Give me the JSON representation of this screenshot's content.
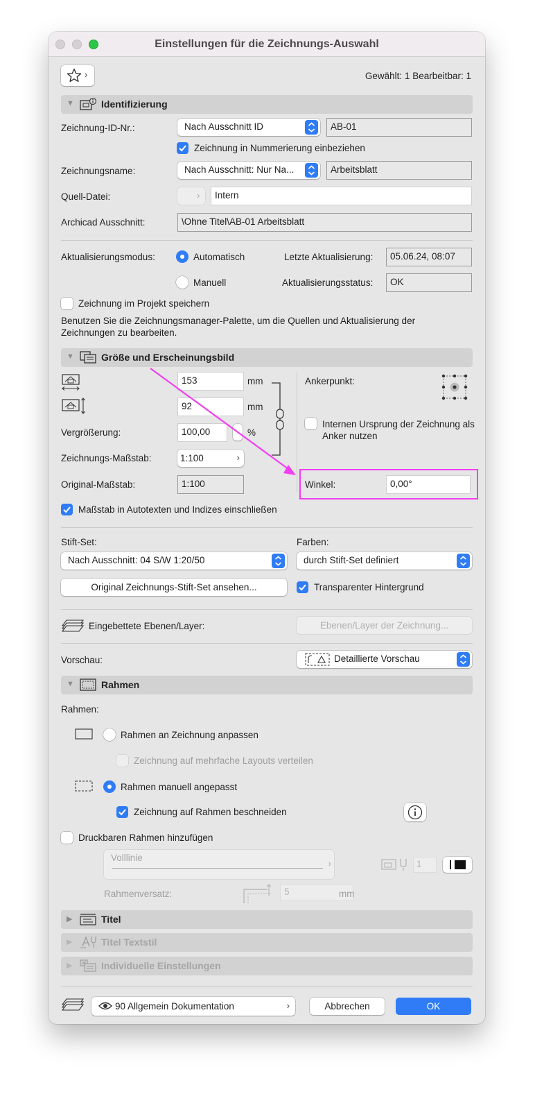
{
  "window": {
    "title": "Einstellungen für die Zeichnungs-Auswahl"
  },
  "header": {
    "selection_status": "Gewählt: 1 Bearbeitbar: 1"
  },
  "sections": {
    "identifizierung": "Identifizierung",
    "groesse": "Größe und Erscheinungsbild",
    "rahmen": "Rahmen",
    "titel": "Titel",
    "titel_textstil": "Titel Textstil",
    "individuelle": "Individuelle Einstellungen"
  },
  "identifizierung": {
    "id_label": "Zeichnung-ID-Nr.:",
    "id_popup": "Nach Ausschnitt ID",
    "id_value": "AB-01",
    "include_numbering": "Zeichnung in Nummerierung einbeziehen",
    "name_label": "Zeichnungsname:",
    "name_popup": "Nach Ausschnitt: Nur Na...",
    "name_value": "Arbeitsblatt",
    "source_label": "Quell-Datei:",
    "source_value": "Intern",
    "view_label": "Archicad Ausschnitt:",
    "view_value": "\\Ohne Titel\\AB-01 Arbeitsblatt",
    "update_mode_label": "Aktualisierungsmodus:",
    "mode_auto": "Automatisch",
    "mode_manual": "Manuell",
    "last_update_label": "Letzte Aktualisierung:",
    "last_update_value": "05.06.24, 08:07",
    "update_status_label": "Aktualisierungsstatus:",
    "update_status_value": "OK",
    "store_in_project": "Zeichnung im Projekt speichern",
    "hint": "Benutzen Sie die Zeichnungsmanager-Palette, um die Quellen und Aktualisierung der Zeichnungen zu bearbeiten."
  },
  "groesse": {
    "width_value": "153",
    "height_value": "92",
    "unit": "mm",
    "magnification_label": "Vergrößerung:",
    "magnification_value": "100,00",
    "percent": "%",
    "scale_label": "Zeichnungs-Maßstab:",
    "scale_value": "1:100",
    "original_scale_label": "Original-Maßstab:",
    "original_scale_value": "1:100",
    "anchor_label": "Ankerpunkt:",
    "internal_origin": "Internen Ursprung der Zeichnung als Anker nutzen",
    "angle_label": "Winkel:",
    "angle_value": "0,00°",
    "scale_in_autotext": "Maßstab in Autotexten und Indizes einschließen",
    "penset_label": "Stift-Set:",
    "penset_value": "Nach Ausschnitt: 04 S/W 1:20/50",
    "colors_label": "Farben:",
    "colors_value": "durch Stift-Set definiert",
    "original_penset_button": "Original Zeichnungs-Stift-Set ansehen...",
    "transparent_bg": "Transparenter Hintergrund",
    "embedded_layers_label": "Eingebettete Ebenen/Layer:",
    "drawing_layers_button": "Ebenen/Layer der Zeichnung...",
    "preview_label": "Vorschau:",
    "preview_value": "Detaillierte Vorschau"
  },
  "rahmen": {
    "label": "Rahmen:",
    "fit_to_drawing": "Rahmen an Zeichnung anpassen",
    "distribute_layouts": "Zeichnung auf mehrfache Layouts verteilen",
    "manual_frame": "Rahmen manuell angepasst",
    "clip_to_frame": "Zeichnung auf Rahmen beschneiden",
    "printable_frame": "Druckbaren Rahmen hinzufügen",
    "line_type": "Volllinie",
    "pen_number": "1",
    "offset_label": "Rahmenversatz:",
    "offset_value": "5",
    "offset_unit": "mm"
  },
  "footer": {
    "layer_popup": "90 Allgemein Dokumentation",
    "cancel": "Abbrechen",
    "ok": "OK"
  },
  "colors": {
    "accent": "#2f7cf6",
    "annotation": "#f23ff0"
  }
}
